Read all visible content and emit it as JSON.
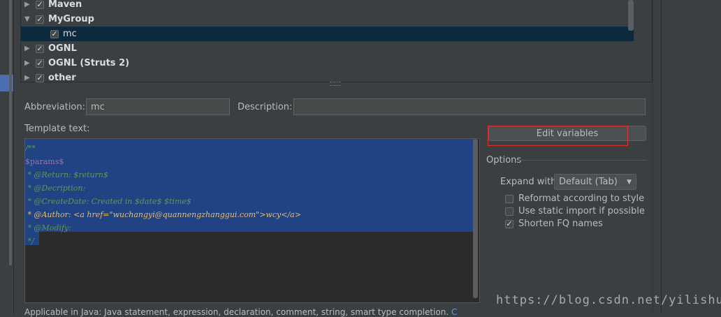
{
  "tree": {
    "items": [
      {
        "label": "Maven",
        "checked": true,
        "expanded": false,
        "bold": true
      },
      {
        "label": "MyGroup",
        "checked": true,
        "expanded": true,
        "bold": true
      },
      {
        "label": "mc",
        "checked": true,
        "child": true,
        "selected": true,
        "bold": false
      },
      {
        "label": "OGNL",
        "checked": true,
        "expanded": false,
        "bold": true
      },
      {
        "label": "OGNL (Struts 2)",
        "checked": true,
        "expanded": false,
        "bold": true
      },
      {
        "label": "other",
        "checked": true,
        "expanded": false,
        "bold": true
      }
    ]
  },
  "form": {
    "abbreviation_label": "Abbreviation:",
    "abbreviation_value": "mc",
    "description_label": "Description:",
    "description_value": "",
    "template_label": "Template text:"
  },
  "template": {
    "lines": [
      "/**",
      "$params$",
      " * @Return: $return$",
      " * @Decription:",
      " * @CreateDate: Created in $date$ $time$",
      " * @Author: <a href=\"wuchangyi@quannengzhanggui.com\">wcy</a>",
      " * @Modify:",
      " */"
    ]
  },
  "options": {
    "edit_variables_label": "Edit variables",
    "title": "Options",
    "expand_with_label": "Expand with",
    "expand_with_value": "Default (Tab)",
    "reformat_label": "Reformat according to style",
    "reformat_checked": false,
    "static_import_label": "Use static import if possible",
    "static_import_checked": false,
    "shorten_fq_label": "Shorten FQ names",
    "shorten_fq_checked": true
  },
  "footer": {
    "applicable_text": "Applicable in Java: Java statement, expression, declaration, comment, string, smart type completion.",
    "change_link": "Change"
  },
  "watermark": "https://blog.csdn.net/yilishuku",
  "colors": {
    "background": "#3c3f41",
    "selection": "#214283",
    "tree_selection": "#0d293e",
    "highlight_border": "#e03232",
    "link": "#589df6"
  }
}
